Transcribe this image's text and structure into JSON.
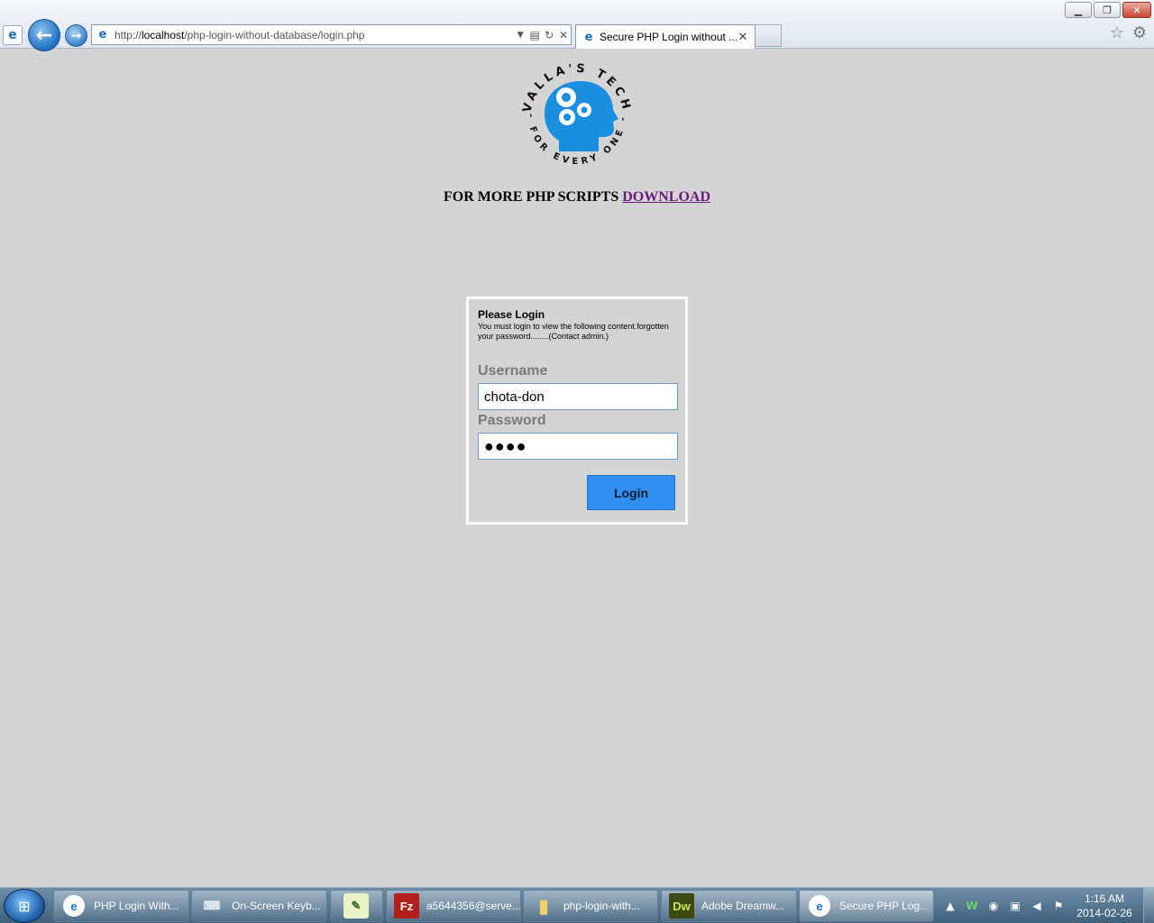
{
  "browser": {
    "address_prefix": "http://",
    "address_host": "localhost",
    "address_path": "/php-login-without-database/login.php",
    "tab_title": "Secure PHP Login without ...",
    "icons": {
      "back": "back-arrow-icon",
      "forward": "forward-arrow-icon",
      "page": "ie-icon",
      "compat": "compatibility-view-icon",
      "refresh": "refresh-icon",
      "stop": "stop-icon",
      "favorites": "star-icon",
      "tools": "gear-icon"
    }
  },
  "page": {
    "logo": {
      "top_text": "VALLA'S TECH",
      "bottom_text": "- FOR EVERY ONE -",
      "color": "#1a8fe0"
    },
    "promo_text": "FOR MORE PHP SCRIPTS ",
    "promo_link": "DOWNLOAD",
    "login": {
      "title": "Please Login",
      "description": "You must login to view the following content.forgotten your password........(Contact admin.)",
      "username_label": "Username",
      "username_value": "chota-don",
      "password_label": "Password",
      "password_value": "●●●●",
      "button_label": "Login",
      "button_color": "#2f90f0"
    }
  },
  "taskbar": {
    "items": [
      {
        "label": "PHP Login With...",
        "icon": "ie-icon"
      },
      {
        "label": "On-Screen Keyb...",
        "icon": "keyboard-icon"
      },
      {
        "label": "",
        "icon": "notepad-plus-icon"
      },
      {
        "label": "a5644356@serve...",
        "icon": "filezilla-icon"
      },
      {
        "label": "php-login-with...",
        "icon": "folder-icon"
      },
      {
        "label": "Adobe Dreamw...",
        "icon": "dreamweaver-icon"
      },
      {
        "label": "Secure PHP Log...",
        "icon": "ie-icon"
      }
    ],
    "clock_time": "1:16 AM",
    "clock_date": "2014-02-26"
  }
}
